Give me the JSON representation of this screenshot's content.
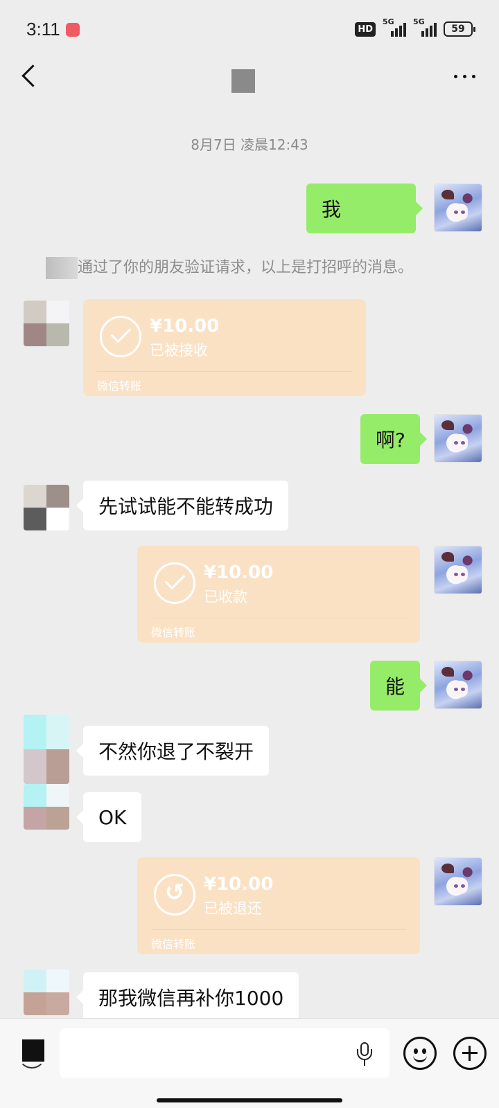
{
  "status_bar": {
    "time": "3:11",
    "hd_label": "HD",
    "network_1": "5G",
    "network_2": "5G",
    "battery": "59"
  },
  "header": {
    "back_icon": "back-chevron-icon",
    "more_icon": "more-dots-icon"
  },
  "chat": {
    "timestamp": "8月7日 凌晨12:43",
    "system_message": "通过了你的朋友验证请求，以上是打招呼的消息。",
    "messages": [
      {
        "side": "out",
        "type": "text",
        "text": "我"
      },
      {
        "side": "in",
        "type": "transfer",
        "amount": "¥10.00",
        "status": "已被接收",
        "brand": "微信转账"
      },
      {
        "side": "out",
        "type": "text",
        "text": "啊?"
      },
      {
        "side": "in",
        "type": "text",
        "text": "先试试能不能转成功"
      },
      {
        "side": "out",
        "type": "transfer",
        "amount": "¥10.00",
        "status": "已收款",
        "brand": "微信转账"
      },
      {
        "side": "out",
        "type": "text",
        "text": "能"
      },
      {
        "side": "in",
        "type": "text",
        "text": "不然你退了不裂开"
      },
      {
        "side": "in",
        "type": "text",
        "text": "OK"
      },
      {
        "side": "out",
        "type": "transfer",
        "amount": "¥10.00",
        "status": "已被退还",
        "brand": "微信转账"
      },
      {
        "side": "in",
        "type": "text",
        "text": "那我微信再补你1000"
      }
    ]
  },
  "input_bar": {
    "placeholder": "",
    "voice_icon": "voice-toggle-icon",
    "mic_icon": "microphone-icon",
    "emoji_icon": "emoji-icon",
    "plus_icon": "plus-icon"
  },
  "colors": {
    "background": "#ededed",
    "outgoing_bubble": "#95ec69",
    "incoming_bubble": "#ffffff",
    "transfer_card": "#fae1c4"
  }
}
